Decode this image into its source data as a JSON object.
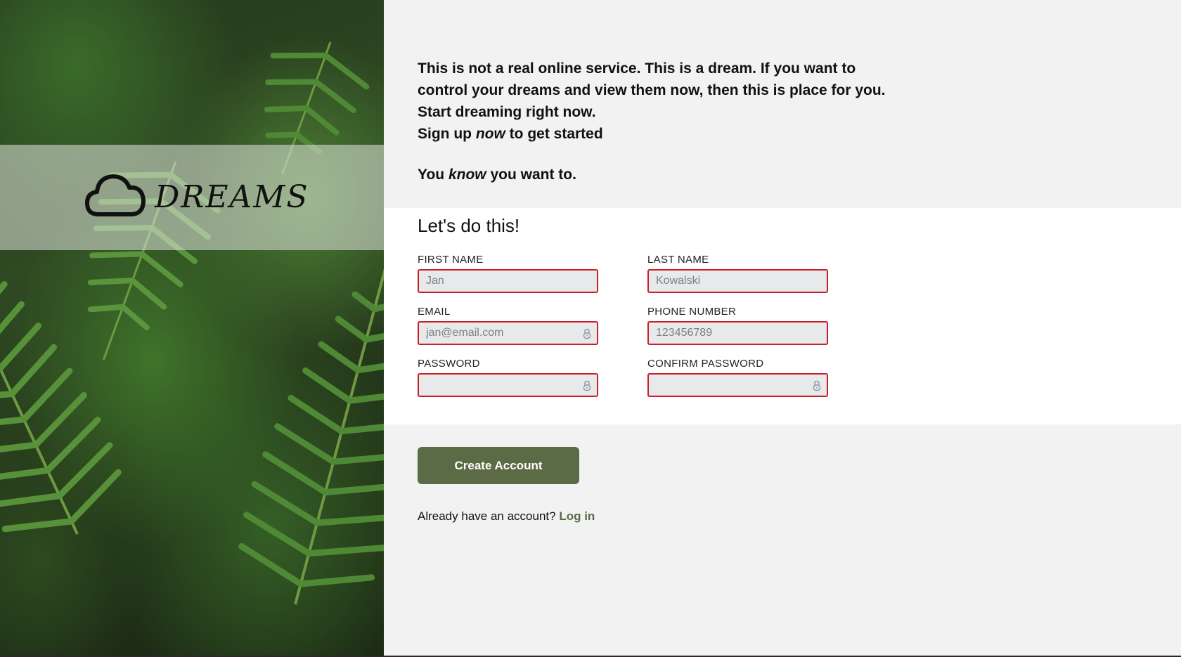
{
  "brand": {
    "name": "DREAMS",
    "icon": "cloud-icon"
  },
  "intro": {
    "line1": "This is not a real online service. This is a dream. If you want to",
    "line2": "control your dreams and view them now, then this is place for you.",
    "line3": "Start dreaming right now.",
    "line4_pre": "Sign up ",
    "line4_em": "now",
    "line4_post": " to get started",
    "line5_pre": "You ",
    "line5_em": "know",
    "line5_post": " you want to."
  },
  "form": {
    "title": "Let's do this!",
    "first_name": {
      "label": "FIRST NAME",
      "placeholder": "Jan"
    },
    "last_name": {
      "label": "LAST NAME",
      "placeholder": "Kowalski"
    },
    "email": {
      "label": "EMAIL",
      "placeholder": "jan@email.com",
      "icon": "lock-icon"
    },
    "phone": {
      "label": "PHONE NUMBER",
      "placeholder": "123456789"
    },
    "password": {
      "label": "PASSWORD",
      "placeholder": "",
      "icon": "lock-icon"
    },
    "confirm_password": {
      "label": "CONFIRM PASSWORD",
      "placeholder": "",
      "icon": "lock-icon"
    },
    "submit_label": "Create Account",
    "login_prompt": "Already have an account?",
    "login_link": "Log in"
  },
  "colors": {
    "accent": "#5b6b45",
    "error_border": "#c8202a",
    "form_bg": "#ffffff",
    "page_bg": "#f2f2f2"
  }
}
